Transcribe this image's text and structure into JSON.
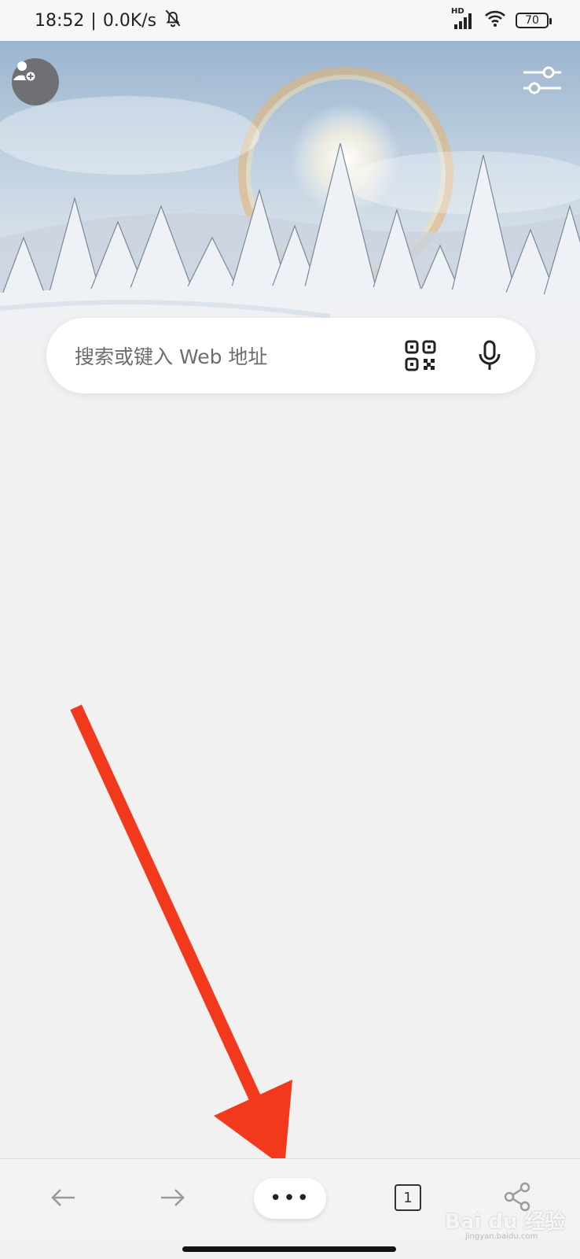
{
  "status_bar": {
    "time": "18:52",
    "separator": "|",
    "network_speed": "0.0K/s",
    "network_type": "HD",
    "battery_level": "70",
    "icons": [
      "bell-off-icon",
      "signal-icon",
      "wifi-icon",
      "battery-icon"
    ]
  },
  "header": {
    "profile_icon": "add-profile-icon",
    "settings_icon": "sliders-icon"
  },
  "search": {
    "placeholder": "搜索或键入 Web 地址",
    "qr_icon": "qr-scan-icon",
    "mic_icon": "microphone-icon"
  },
  "toolbar": {
    "back_icon": "arrow-left-icon",
    "forward_icon": "arrow-right-icon",
    "more_label": "•••",
    "tab_count": "1",
    "share_icon": "share-icon"
  },
  "watermark": {
    "text": "Bai du 经验",
    "sub": "jingyan.baidu.com"
  },
  "colors": {
    "background": "#f1f1f2",
    "annotation_arrow": "#f3391c",
    "search_box": "#ffffff"
  }
}
